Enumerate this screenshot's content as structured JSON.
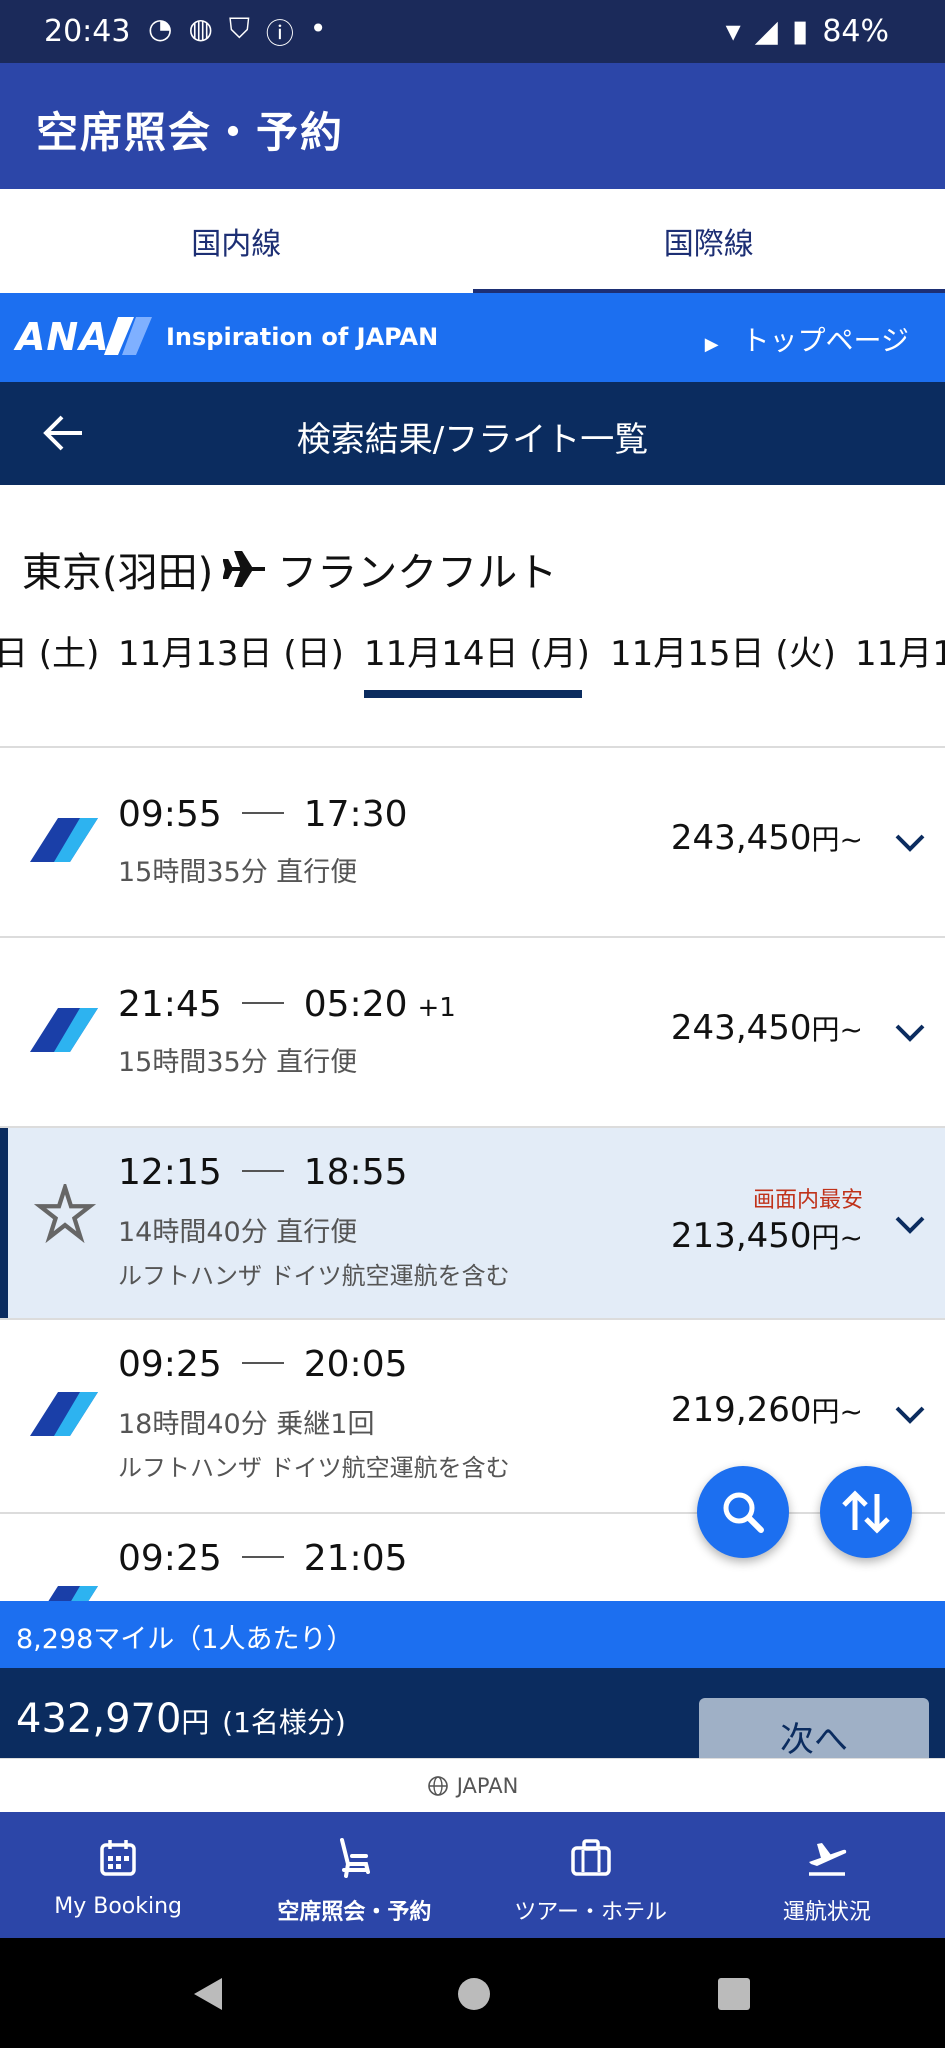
{
  "status_bar": {
    "time": "20:43",
    "battery": "84%"
  },
  "app_header": {
    "title": "空席照会・予約"
  },
  "tabs": [
    {
      "label": "国内線",
      "active": false
    },
    {
      "label": "国際線",
      "active": true
    }
  ],
  "ana_banner": {
    "logo": "ANA",
    "tagline": "Inspiration of JAPAN",
    "top_link": "トップページ"
  },
  "nav_header": {
    "title": "検索結果/フライト一覧"
  },
  "route": {
    "origin": "東京(羽田)",
    "destination": "フランクフルト"
  },
  "dates": [
    {
      "label": "日 (土)"
    },
    {
      "label": "11月13日 (日)"
    },
    {
      "label": "11月14日 (月)",
      "selected": true
    },
    {
      "label": "11月15日 (火)"
    },
    {
      "label": "11月1"
    }
  ],
  "flights": [
    {
      "depart": "09:55",
      "arrive": "17:30",
      "plus_day": "",
      "duration": "15時間35分 直行便",
      "note": "",
      "price": "243,450",
      "yen": "円~",
      "badge": "",
      "airline": "ANA"
    },
    {
      "depart": "21:45",
      "arrive": "05:20",
      "plus_day": "+1",
      "duration": "15時間35分 直行便",
      "note": "",
      "price": "243,450",
      "yen": "円~",
      "badge": "",
      "airline": "ANA"
    },
    {
      "depart": "12:15",
      "arrive": "18:55",
      "plus_day": "",
      "duration": "14時間40分 直行便",
      "note": "ルフトハンザ ドイツ航空運航を含む",
      "price": "213,450",
      "yen": "円~",
      "badge": "画面内最安",
      "airline": "Star Alliance"
    },
    {
      "depart": "09:25",
      "arrive": "20:05",
      "plus_day": "",
      "duration": "18時間40分 乗継1回",
      "note": "ルフトハンザ ドイツ航空運航を含む",
      "price": "219,260",
      "yen": "円~",
      "badge": "",
      "airline": "ANA"
    },
    {
      "depart": "09:25",
      "arrive": "21:05",
      "plus_day": "",
      "duration": "",
      "note": "",
      "price": "",
      "yen": "",
      "badge": "",
      "airline": "ANA"
    }
  ],
  "summary": {
    "miles": "8,298マイル（1人あたり）",
    "total": "432,970",
    "total_unit": "円",
    "per_person": "(1名様分)",
    "next_button": "次へ"
  },
  "region": {
    "label": "JAPAN"
  },
  "bottom_nav": [
    {
      "label": "My Booking",
      "icon": "calendar-icon",
      "active": false
    },
    {
      "label": "空席照会・予約",
      "icon": "seat-icon",
      "active": true
    },
    {
      "label": "ツアー・ホテル",
      "icon": "suitcase-icon",
      "active": false
    },
    {
      "label": "運航状況",
      "icon": "plane-takeoff-icon",
      "active": false
    }
  ],
  "colors": {
    "header_blue": "#2c46a8",
    "banner_blue": "#1c6ff0",
    "navy": "#0b2c5f",
    "highlight_row": "#e3ecf7",
    "cheapest_red": "#c0321a"
  }
}
